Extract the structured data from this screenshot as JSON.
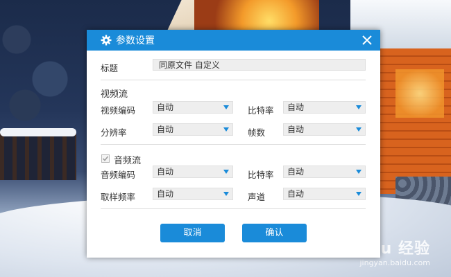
{
  "dialog": {
    "title": "参数设置",
    "icon": "gear-icon",
    "accent_color": "#1a8bd9"
  },
  "title_field": {
    "label": "标题",
    "value": "同原文件 自定义"
  },
  "video": {
    "section_title": "视频流",
    "codec_label": "视频编码",
    "codec_value": "自动",
    "bitrate_label": "比特率",
    "bitrate_value": "自动",
    "resolution_label": "分辨率",
    "resolution_value": "自动",
    "framerate_label": "帧数",
    "framerate_value": "自动"
  },
  "audio": {
    "section_title": "音频流",
    "enabled": true,
    "codec_label": "音频编码",
    "codec_value": "自动",
    "bitrate_label": "比特率",
    "bitrate_value": "自动",
    "samplerate_label": "取样频率",
    "samplerate_value": "自动",
    "channel_label": "声道",
    "channel_value": "自动"
  },
  "buttons": {
    "cancel_label": "取消",
    "confirm_label": "确认"
  },
  "watermark": {
    "main": "Baidu 经验",
    "sub": "jingyan.baidu.com"
  }
}
